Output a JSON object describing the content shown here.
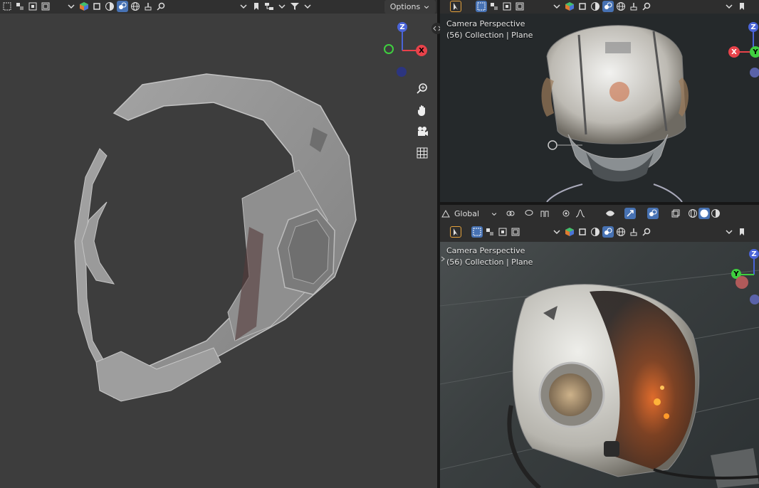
{
  "left_viewport": {
    "header": {
      "options_label": "Options"
    }
  },
  "top_right_viewport": {
    "view_label": "Camera Perspective",
    "collection_label": "(56) Collection | Plane",
    "gizmo": {
      "z": "Z",
      "x": "X",
      "y": "Y"
    }
  },
  "bottom_right_viewport": {
    "orientation_label": "Global",
    "view_label": "Camera Perspective",
    "collection_label": "(56) Collection | Plane",
    "gizmo": {
      "z": "Z",
      "y": "Y"
    }
  },
  "left_gizmo": {
    "z": "Z",
    "x": "X"
  },
  "colors": {
    "accent": "#4772b3",
    "axis_x": "#e8424a",
    "axis_y": "#3fcf3f",
    "axis_z": "#4a64d8"
  }
}
